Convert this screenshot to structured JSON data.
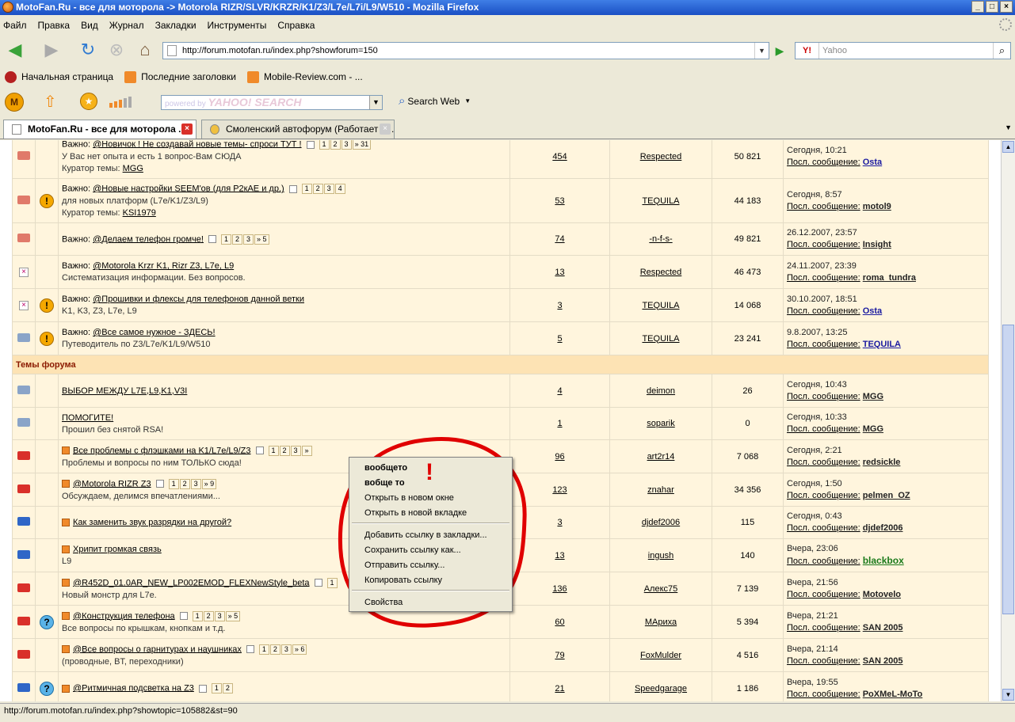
{
  "window": {
    "title": "MotoFan.Ru - все для моторола -> Motorola RIZR/SLVR/KRZR/K1/Z3/L7e/L7i/L9/W510 - Mozilla Firefox"
  },
  "menu": [
    "Файл",
    "Правка",
    "Вид",
    "Журнал",
    "Закладки",
    "Инструменты",
    "Справка"
  ],
  "nav": {
    "url": "http://forum.motofan.ru/index.php?showforum=150",
    "search_engine": "Y!",
    "search_placeholder": "Yahoo"
  },
  "bookmarks": [
    "Начальная страница",
    "Последние заголовки",
    "Mobile-Review.com - ..."
  ],
  "yahoo_toolbar": {
    "search_hint": "powered by",
    "search_brand": "YAHOO! SEARCH",
    "search_web": "Search Web"
  },
  "tabs": [
    {
      "label": "MotoFan.Ru - все для моторола ..."
    },
    {
      "label": "Смоленский автофорум (Работает н..."
    }
  ],
  "colors": {
    "folder_red": "#d9302a",
    "folder_grey": "#8aa4c8",
    "folder_blue": "#2f66c7",
    "annotation": "#e00000"
  },
  "pinned": [
    {
      "folder": "pink",
      "extra": "",
      "prefix": "Важно: ",
      "title": "@Новичок ! Не создавай новые темы- спроси ТУТ !",
      "pages": [
        "1",
        "2",
        "3",
        "» 31"
      ],
      "desc": "У Вас нет опыта и есть 1 вопрос-Вам СЮДА",
      "curator_label": "Куратор темы: ",
      "curator": "MGG",
      "replies": "454",
      "author": "Respected",
      "views": "50 821",
      "date": "Сегодня, 10:21",
      "last_label": "Посл. сообщение:",
      "last": "Osta"
    },
    {
      "folder": "pink",
      "extra": "warn",
      "prefix": "Важно: ",
      "title": "@Новые настройки SEEM'ов (для P2кАЕ и др.)",
      "pages": [
        "1",
        "2",
        "3",
        "4"
      ],
      "desc": "для новых платформ (L7e/K1/Z3/L9)",
      "curator_label": "Куратор темы: ",
      "curator": "KSI1979",
      "replies": "53",
      "author": "TEQUILA",
      "views": "44 183",
      "date": "Сегодня, 8:57",
      "last_label": "Посл. сообщение:",
      "last": "motol9"
    },
    {
      "folder": "pink",
      "extra": "",
      "prefix": "Важно: ",
      "title": "@Делаем телефон громче!",
      "pages": [
        "1",
        "2",
        "3",
        "» 5"
      ],
      "desc": "",
      "curator_label": "",
      "curator": "",
      "replies": "74",
      "author": "-n-f-s-",
      "views": "49 821",
      "date": "26.12.2007, 23:57",
      "last_label": "Посл. сообщение:",
      "last": "Insight"
    },
    {
      "folder": "x",
      "extra": "",
      "prefix": "Важно: ",
      "title": "@Motorola Krzr K1, Rizr Z3, L7e, L9",
      "pages": [],
      "desc": "Систематизация информации. Без вопросов.",
      "curator_label": "",
      "curator": "",
      "replies": "13",
      "author": "Respected",
      "views": "46 473",
      "date": "24.11.2007, 23:39",
      "last_label": "Посл. сообщение:",
      "last": "roma_tundra"
    },
    {
      "folder": "x",
      "extra": "warn",
      "prefix": "Важно: ",
      "title": "@Прошивки и флексы для телефонов данной ветки",
      "pages": [],
      "desc": "K1, K3, Z3, L7e, L9",
      "curator_label": "",
      "curator": "",
      "replies": "3",
      "author": "TEQUILA",
      "views": "14 068",
      "date": "30.10.2007, 18:51",
      "last_label": "Посл. сообщение:",
      "last": "Osta"
    },
    {
      "folder": "grey",
      "extra": "warn",
      "prefix": "Важно: ",
      "title": "@Все самое нужное - ЗДЕСЬ!",
      "pages": [],
      "desc": "Путеводитель по Z3/L7e/K1/L9/W510",
      "curator_label": "",
      "curator": "",
      "replies": "5",
      "author": "TEQUILA",
      "views": "23 241",
      "date": "9.8.2007, 13:25",
      "last_label": "Посл. сообщение:",
      "last": "TEQUILA"
    }
  ],
  "section_title": "Темы форума",
  "topics": [
    {
      "folder": "grey",
      "extra": "",
      "hot": false,
      "title": "ВЫБОР МЕЖДУ L7E,L9,K1,V3I",
      "pages": [],
      "desc": "",
      "replies": "4",
      "author": "deimon",
      "views": "26",
      "date": "Сегодня, 10:43",
      "last_label": "Посл. сообщение:",
      "last": "MGG"
    },
    {
      "folder": "grey",
      "extra": "",
      "hot": false,
      "title": "ПОМОГИТЕ!",
      "pages": [],
      "desc": "Прошил без снятой RSA!",
      "replies": "1",
      "author": "soparik",
      "views": "0",
      "date": "Сегодня, 10:33",
      "last_label": "Посл. сообщение:",
      "last": "MGG"
    },
    {
      "folder": "red",
      "extra": "",
      "hot": true,
      "title": "Все проблемы с флэшками на K1/L7e/L9/Z3",
      "pages": [
        "1",
        "2",
        "3",
        "»"
      ],
      "desc": "Проблемы и вопросы по ним ТОЛЬКО сюда!",
      "replies": "96",
      "author": "art2r14",
      "views": "7 068",
      "date": "Сегодня, 2:21",
      "last_label": "Посл. сообщение:",
      "last": "redsickle"
    },
    {
      "folder": "red",
      "extra": "",
      "hot": true,
      "title": "@Motorola RIZR Z3",
      "pages": [
        "1",
        "2",
        "3",
        "» 9"
      ],
      "desc": "Обсуждаем, делимся впечатлениями...",
      "replies": "123",
      "author": "znahar",
      "views": "34 356",
      "date": "Сегодня, 1:50",
      "last_label": "Посл. сообщение:",
      "last": "pelmen_OZ"
    },
    {
      "folder": "blue",
      "extra": "",
      "hot": true,
      "title": "Как заменить звук разрядки на другой?",
      "pages": [],
      "desc": "",
      "replies": "3",
      "author": "djdef2006",
      "views": "115",
      "date": "Сегодня, 0:43",
      "last_label": "Посл. сообщение:",
      "last": "djdef2006"
    },
    {
      "folder": "blue",
      "extra": "",
      "hot": true,
      "title": "Хрипит громкая связь",
      "pages": [],
      "desc": "L9",
      "replies": "13",
      "author": "ingush",
      "views": "140",
      "date": "Вчера, 23:06",
      "last_label": "Посл. сообщение:",
      "last": "blackbox"
    },
    {
      "folder": "red",
      "extra": "",
      "hot": true,
      "title": "@R452D_01.0AR_NEW_LP002EMOD_FLEXNewStyle_beta",
      "pages": [
        "1"
      ],
      "desc": "Новый монстр для L7e.",
      "replies": "136",
      "author": "Алекс75",
      "views": "7 139",
      "date": "Вчера, 21:56",
      "last_label": "Посл. сообщение:",
      "last": "Motovelo"
    },
    {
      "folder": "red",
      "extra": "ques",
      "hot": true,
      "title": "@Конструкция телефона",
      "pages": [
        "1",
        "2",
        "3",
        "» 5"
      ],
      "desc": "Все вопросы по крышкам, кнопкам и т.д.",
      "replies": "60",
      "author": "МАриха",
      "views": "5 394",
      "date": "Вчера, 21:21",
      "last_label": "Посл. сообщение:",
      "last": "SAN 2005"
    },
    {
      "folder": "red",
      "extra": "",
      "hot": true,
      "title": "@Все вопросы о гарнитурах и наушниках",
      "pages": [
        "1",
        "2",
        "3",
        "» 6"
      ],
      "desc": "(проводные, BT, переходники)",
      "replies": "79",
      "author": "FoxMulder",
      "views": "4 516",
      "date": "Вчера, 21:14",
      "last_label": "Посл. сообщение:",
      "last": "SAN 2005"
    },
    {
      "folder": "blue",
      "extra": "ques",
      "hot": true,
      "title": "@Ритмичная подсветка на Z3",
      "pages": [
        "1",
        "2"
      ],
      "desc": "",
      "replies": "21",
      "author": "Speedgarage",
      "views": "1 186",
      "date": "Вчера, 19:55",
      "last_label": "Посл. сообщение:",
      "last": "PoXMeL-MoTo"
    }
  ],
  "context_menu": {
    "items": [
      "вообщето",
      "вобще то",
      "Открыть в новом окне",
      "Открыть в новой вкладке",
      "Добавить ссылку в закладки...",
      "Сохранить ссылку как...",
      "Отправить ссылку...",
      "Копировать ссылку",
      "Свойства"
    ]
  },
  "status": "http://forum.motofan.ru/index.php?showtopic=105882&st=90"
}
